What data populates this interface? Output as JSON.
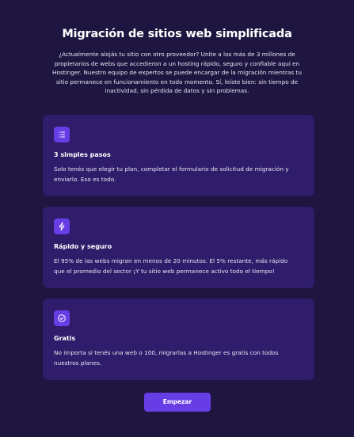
{
  "section": {
    "title": "Migración de sitios web simplificada",
    "intro": "¿Actualmente alojás tu sitio con otro proveedor? Unite a los más de 3 millones de propietarios de webs que accedieron a un hosting rápido, seguro y confiable aquí en Hostinger. Nuestro equipo de expertos se puede encargar de la migración mientras tu sitio permanece en funcionamiento en todo momento. Sí, leíste bien: sin tiempo de inactividad, sin pérdida de datos y sin problemas."
  },
  "cards": [
    {
      "icon": "list-icon",
      "heading": "3 simples pasos",
      "text": "Solo tenés que elegir tu plan, completar el formulario de solicitud de migración y enviarlo. Eso es todo."
    },
    {
      "icon": "lightning-icon",
      "heading": "Rápido y seguro",
      "text": "El 95% de las webs migran en menos de 20 minutos. El 5% restante, más rápido que el promedio del sector ¡Y tu sitio web permanece activo todo el tiempo!"
    },
    {
      "icon": "check-circle-icon",
      "heading": "Gratis",
      "text": "No importa si tenés una web o 100, migrarlas a Hostinger es gratis con todos nuestros planes."
    }
  ],
  "cta": {
    "label": "Empezar"
  },
  "colors": {
    "background": "#1e1540",
    "card": "#2f1c6a",
    "accent": "#673de6",
    "text": "#ffffff"
  }
}
